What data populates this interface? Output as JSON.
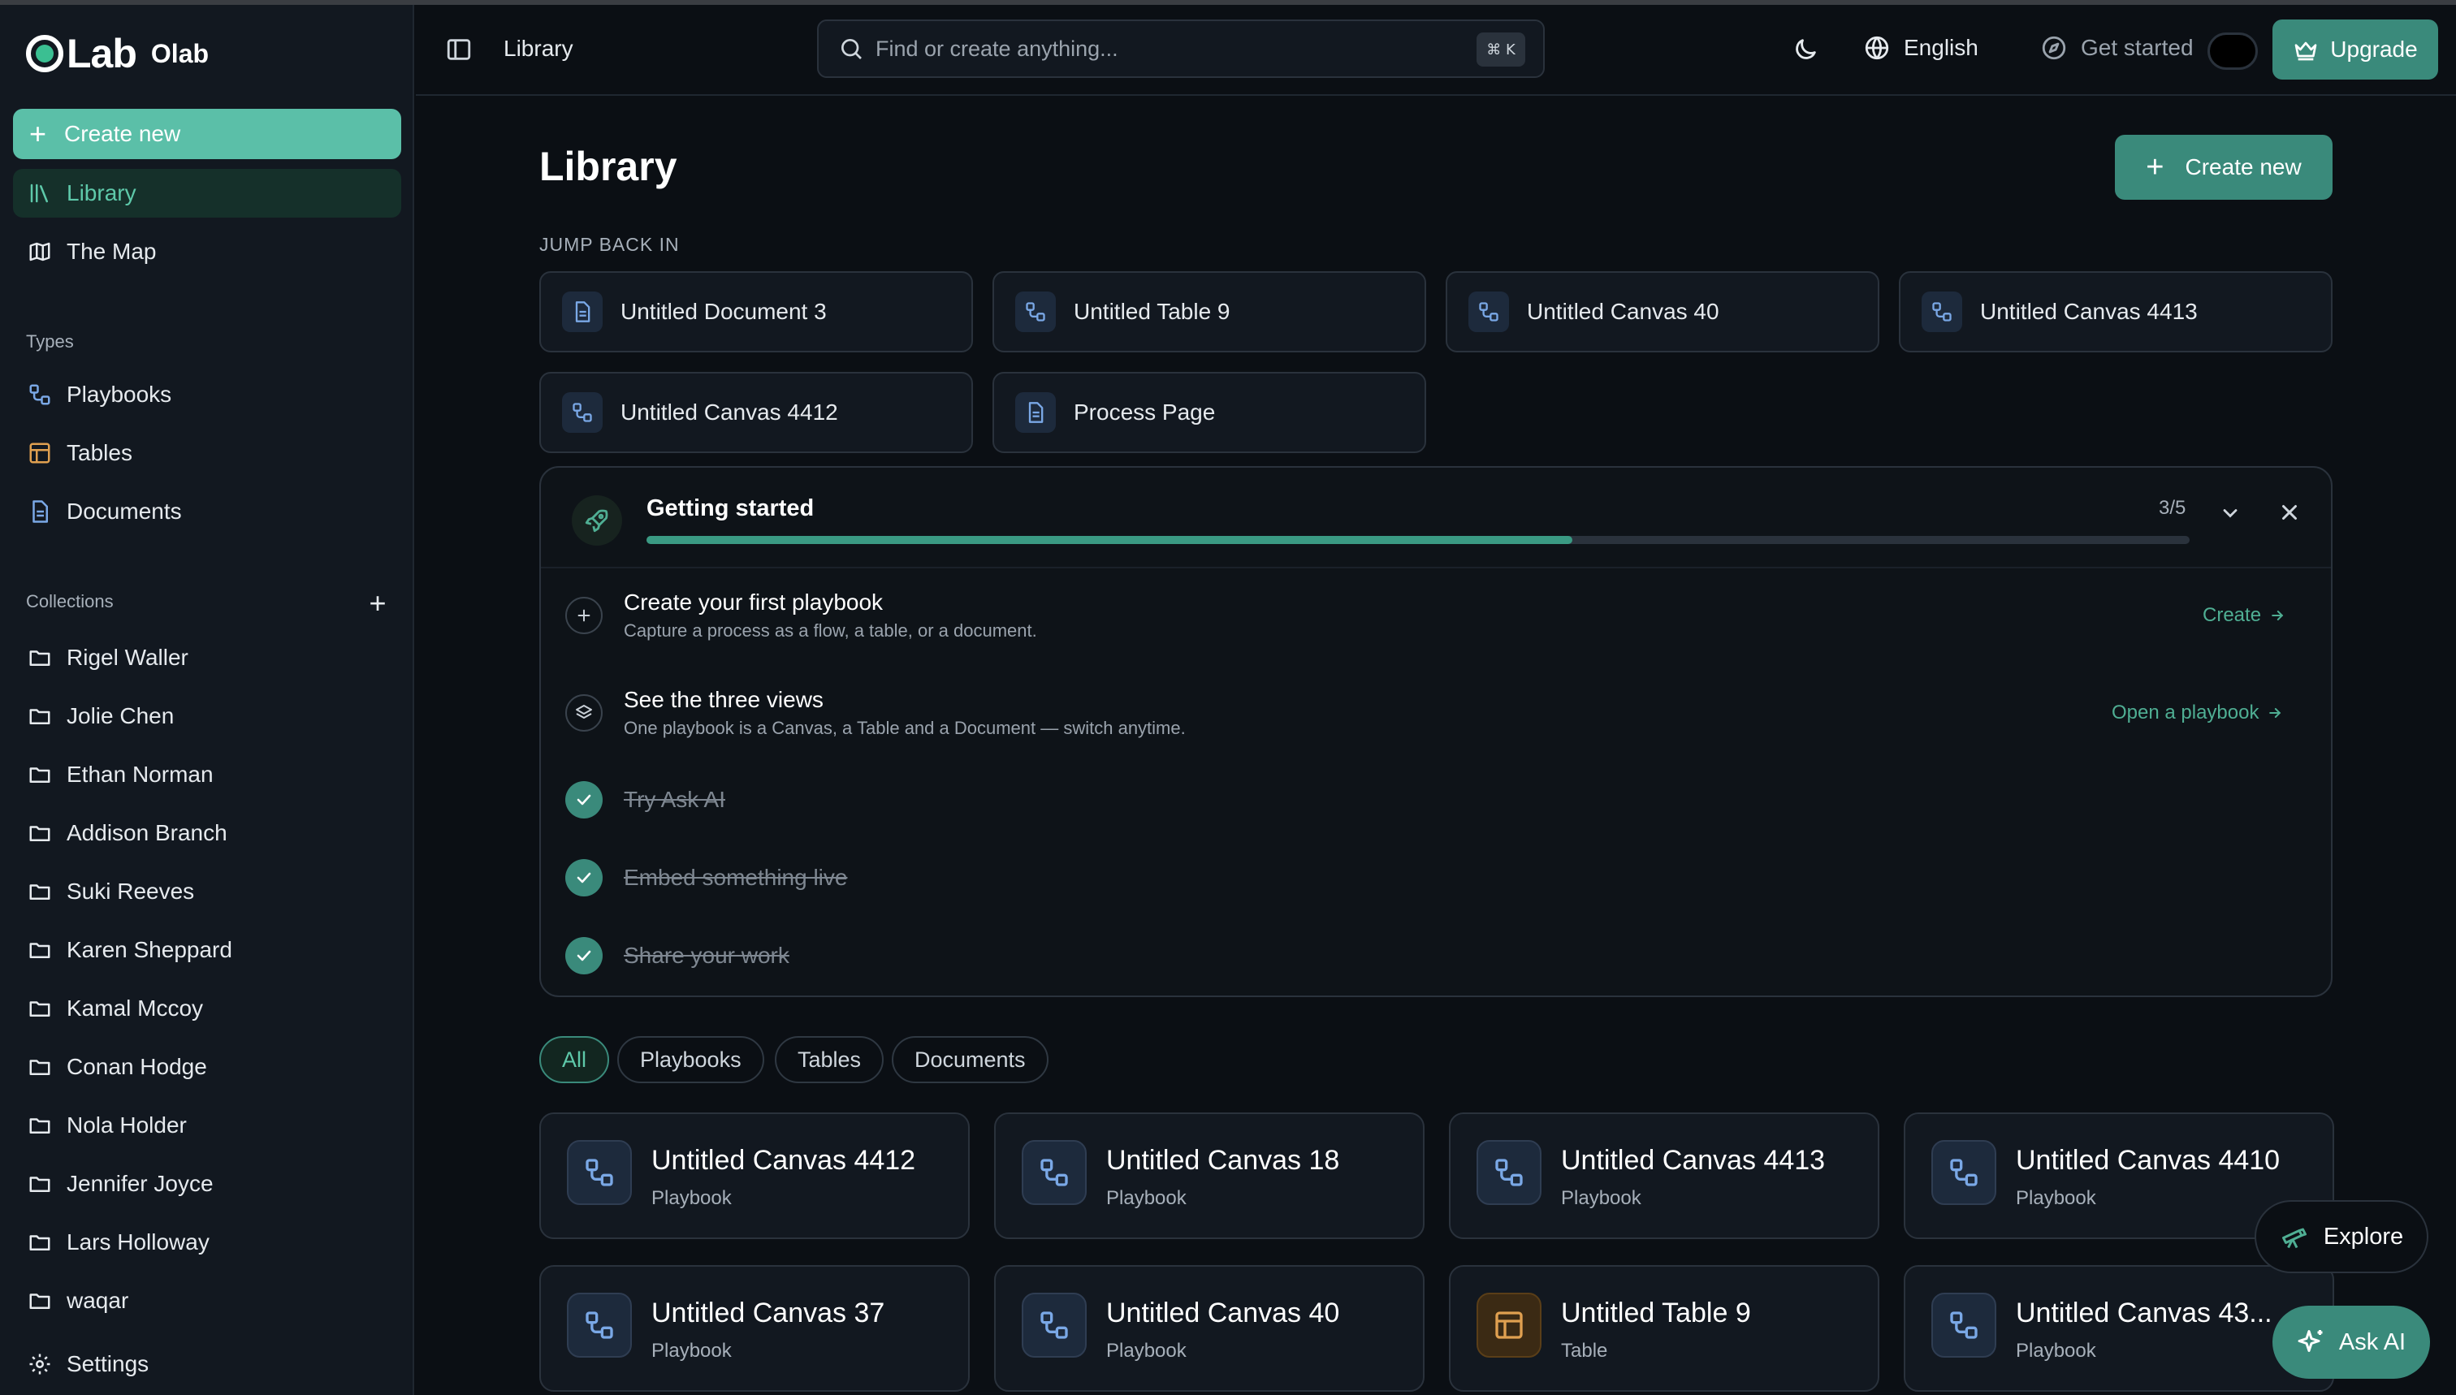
{
  "app": {
    "logo_word": "Lab",
    "workspace": "Olab"
  },
  "sidebar": {
    "create_label": "Create new",
    "nav": [
      {
        "label": "Library",
        "icon": "library-icon",
        "active": true
      },
      {
        "label": "The Map",
        "icon": "map-icon",
        "active": false
      }
    ],
    "types_label": "Types",
    "types": [
      {
        "label": "Playbooks",
        "icon": "playbook-icon"
      },
      {
        "label": "Tables",
        "icon": "table-icon"
      },
      {
        "label": "Documents",
        "icon": "document-icon"
      }
    ],
    "collections_label": "Collections",
    "collections": [
      "Rigel Waller",
      "Jolie Chen",
      "Ethan Norman",
      "Addison Branch",
      "Suki Reeves",
      "Karen Sheppard",
      "Kamal Mccoy",
      "Conan Hodge",
      "Nola Holder",
      "Jennifer Joyce",
      "Lars Holloway",
      "waqar"
    ],
    "settings_label": "Settings"
  },
  "topbar": {
    "breadcrumb": "Library",
    "search_placeholder": "Find or create anything...",
    "search_shortcut": "⌘ K",
    "language": "English",
    "get_started": "Get started",
    "upgrade": "Upgrade"
  },
  "main": {
    "title": "Library",
    "create_label": "Create new",
    "jump_label": "JUMP BACK IN",
    "jump_items": [
      {
        "label": "Untitled Document 3",
        "icon": "document-icon"
      },
      {
        "label": "Untitled Table 9",
        "icon": "playbook-icon"
      },
      {
        "label": "Untitled Canvas 40",
        "icon": "playbook-icon"
      },
      {
        "label": "Untitled Canvas 4413",
        "icon": "playbook-icon"
      },
      {
        "label": "Untitled Canvas 4412",
        "icon": "playbook-icon"
      },
      {
        "label": "Process Page",
        "icon": "document-icon"
      }
    ],
    "getting_started": {
      "title": "Getting started",
      "count": "3/5",
      "progress": 0.6,
      "tasks": [
        {
          "title": "Create your first playbook",
          "subtitle": "Capture a process as a flow, a table, or a document.",
          "link": "Create",
          "done": false,
          "icon": "plus-icon"
        },
        {
          "title": "See the three views",
          "subtitle": "One playbook is a Canvas, a Table and a Document — switch anytime.",
          "link": "Open a playbook",
          "done": false,
          "icon": "layers-icon"
        },
        {
          "title": "Try Ask AI",
          "done": true
        },
        {
          "title": "Embed something live",
          "done": true
        },
        {
          "title": "Share your work",
          "done": true
        }
      ]
    },
    "filters": [
      "All",
      "Playbooks",
      "Tables",
      "Documents"
    ],
    "active_filter": "All",
    "cards": [
      {
        "title": "Untitled Canvas 4412",
        "type": "Playbook"
      },
      {
        "title": "Untitled Canvas 18",
        "type": "Playbook"
      },
      {
        "title": "Untitled Canvas 4413",
        "type": "Playbook"
      },
      {
        "title": "Untitled Canvas 4410",
        "type": "Playbook"
      },
      {
        "title": "Untitled Canvas 37",
        "type": "Playbook"
      },
      {
        "title": "Untitled Canvas 40",
        "type": "Playbook"
      },
      {
        "title": "Untitled Table 9",
        "type": "Table"
      },
      {
        "title": "Untitled Canvas 43...",
        "type": "Playbook"
      }
    ],
    "explore_label": "Explore",
    "ask_ai_label": "Ask AI"
  },
  "colors": {
    "accent": "#3a8a7b",
    "accent_light": "#5bbfa8",
    "table_icon": "#e0a050",
    "playbook_icon": "#7aa8e6"
  }
}
